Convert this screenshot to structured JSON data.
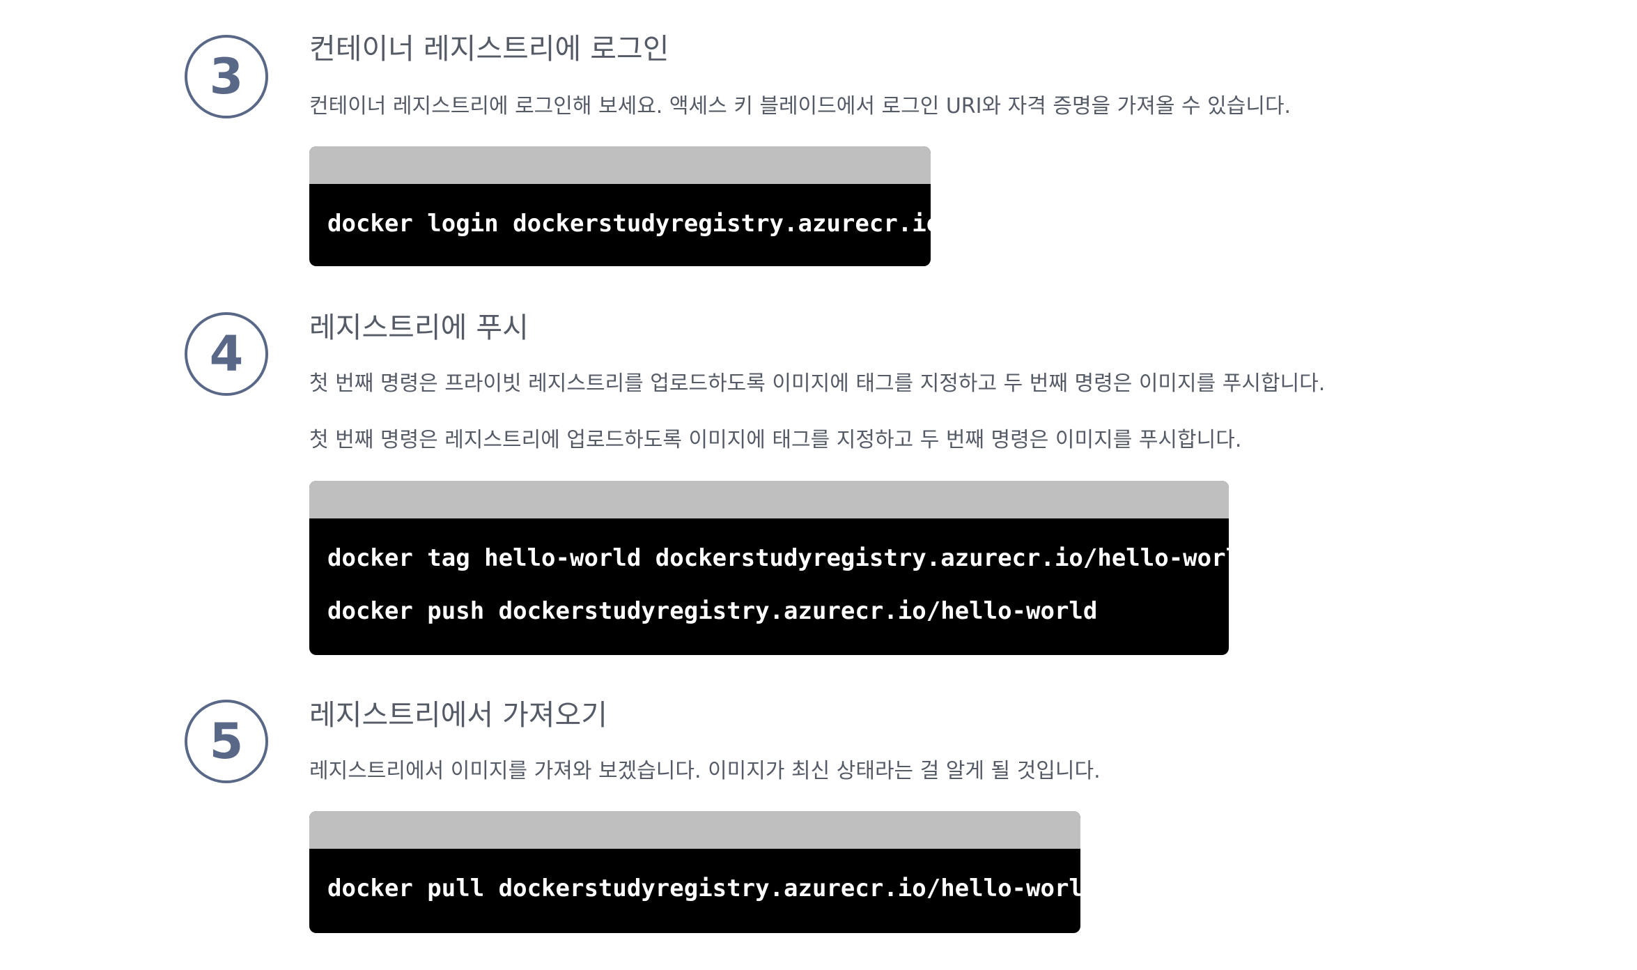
{
  "steps": [
    {
      "number": "3",
      "title": "컨테이너 레지스트리에 로그인",
      "descriptions": [
        "컨테이너 레지스트리에 로그인해 보세요. 액세스 키 블레이드에서 로그인 URI와 자격 증명을 가져올 수 있습니다."
      ],
      "code": [
        "docker login dockerstudyregistry.azurecr.io"
      ]
    },
    {
      "number": "4",
      "title": "레지스트리에 푸시",
      "descriptions": [
        "첫 번째 명령은 프라이빗 레지스트리를 업로드하도록 이미지에 태그를 지정하고 두 번째 명령은 이미지를 푸시합니다.",
        "첫 번째 명령은 레지스트리에 업로드하도록 이미지에 태그를 지정하고 두 번째 명령은 이미지를 푸시합니다."
      ],
      "code": [
        "docker tag hello-world dockerstudyregistry.azurecr.io/hello-world",
        "docker push dockerstudyregistry.azurecr.io/hello-world"
      ]
    },
    {
      "number": "5",
      "title": "레지스트리에서 가져오기",
      "descriptions": [
        "레지스트리에서 이미지를 가져와 보겠습니다. 이미지가 최신 상태라는 걸 알게 될 것입니다."
      ],
      "code": [
        "docker pull dockerstudyregistry.azurecr.io/hello-world"
      ]
    }
  ]
}
